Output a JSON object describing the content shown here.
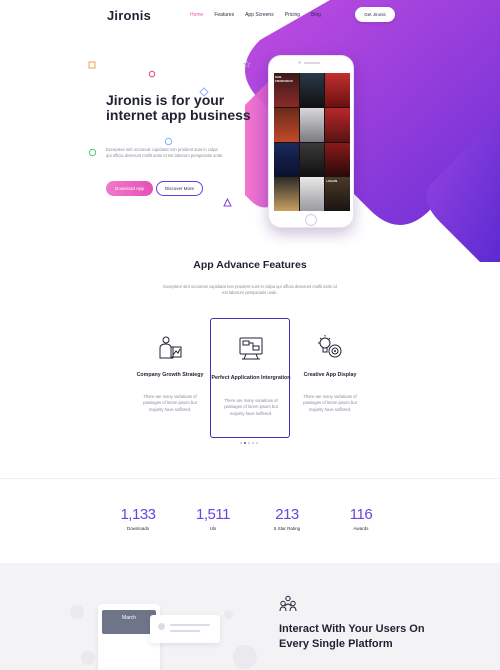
{
  "brand": "Jironis",
  "nav": {
    "items": [
      "Home",
      "Features",
      "App Screens",
      "Pricing",
      "Blog"
    ],
    "active_index": 0,
    "cta": "Get Jironis"
  },
  "hero": {
    "title": "Jironis is for your internet app business",
    "text": "Excepteur sint occaecat cupidatat non proident sunt in culpa qui officia deserunt mollit anim id est laborum perspiciatis unde.",
    "download_label": "Download App",
    "discover_label": "Discover More",
    "posters": [
      "SAN FRANCISCO",
      "",
      "",
      "",
      "",
      "",
      "",
      "",
      "",
      "",
      "",
      "LOGAN"
    ]
  },
  "features": {
    "title": "App Advance Features",
    "text": "Excepteur sint occaecat cupidatat non proident sunt in culpa qui officia deserunt mollit anim id est laborum perspiciatis unde.",
    "cards": [
      {
        "title": "Company Growth Strategy",
        "text": "There are many variations of passages of lorem ipsum but majority have suffered.",
        "icon": "growth-icon"
      },
      {
        "title": "Perfect Application Intergration",
        "text": "There are many variations of passages of lorem ipsum but majority have suffered.",
        "icon": "integration-icon"
      },
      {
        "title": "Creative App Display",
        "text": "There are many variations of passages of lorem ipsum but majority have suffered.",
        "icon": "creative-icon"
      }
    ],
    "active_card": 1,
    "slides": 5,
    "active_slide": 1
  },
  "stats": [
    {
      "value": "1,133",
      "label": "Downloads"
    },
    {
      "value": "1,511",
      "label": "Uls"
    },
    {
      "value": "213",
      "label": "5 Star Rating"
    },
    {
      "value": "116",
      "label": "Awards"
    }
  ],
  "interact": {
    "title": "Interact With Your Users On Every Single Platform",
    "mock_month": "March"
  },
  "colors": {
    "accent_purple": "#6a3ae0",
    "accent_pink": "#e451b9",
    "text_dark": "#1f2233",
    "text_muted": "#8a8c9a"
  }
}
